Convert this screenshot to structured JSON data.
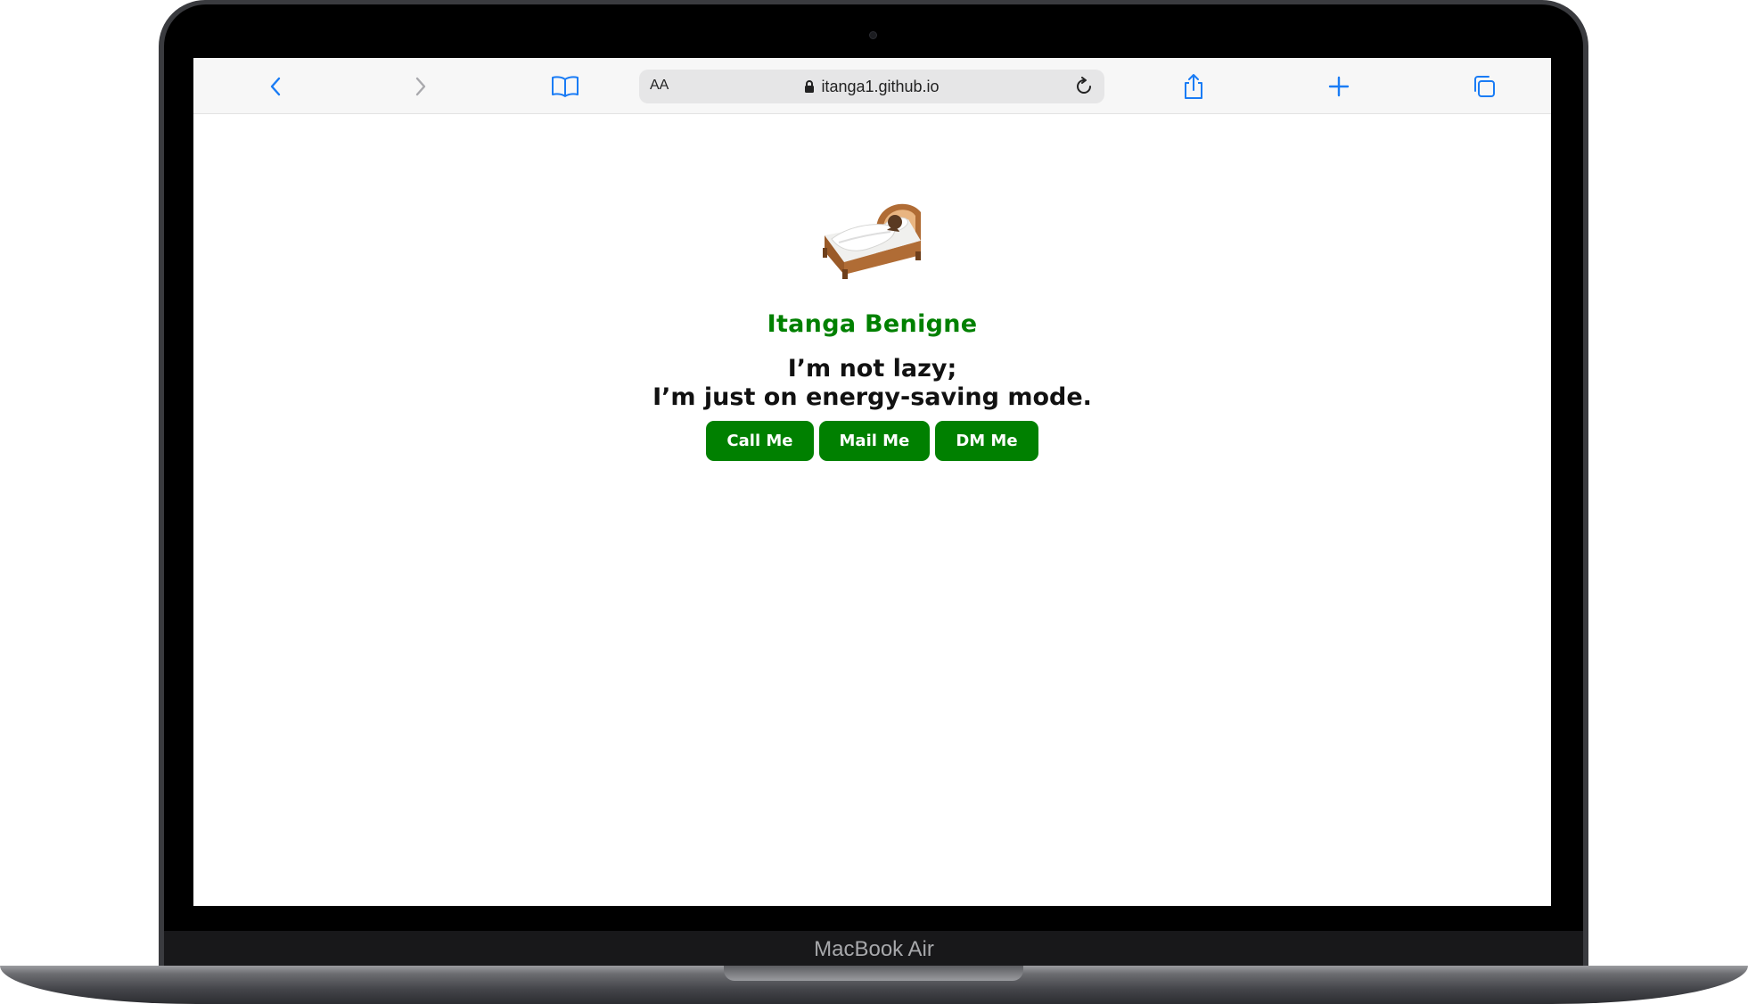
{
  "browser": {
    "text_size_label": "AA",
    "url": "itanga1.github.io"
  },
  "page": {
    "emoji": "🛌",
    "name": "Itanga Benigne",
    "tagline_line1": "I’m not lazy;",
    "tagline_line2": "I’m just on energy-saving mode.",
    "buttons": [
      {
        "label": "Call Me"
      },
      {
        "label": "Mail Me"
      },
      {
        "label": "DM Me"
      }
    ]
  },
  "device": {
    "label": "MacBook Air"
  },
  "colors": {
    "accent_green": "#008000",
    "ios_blue": "#1a7cf5"
  }
}
